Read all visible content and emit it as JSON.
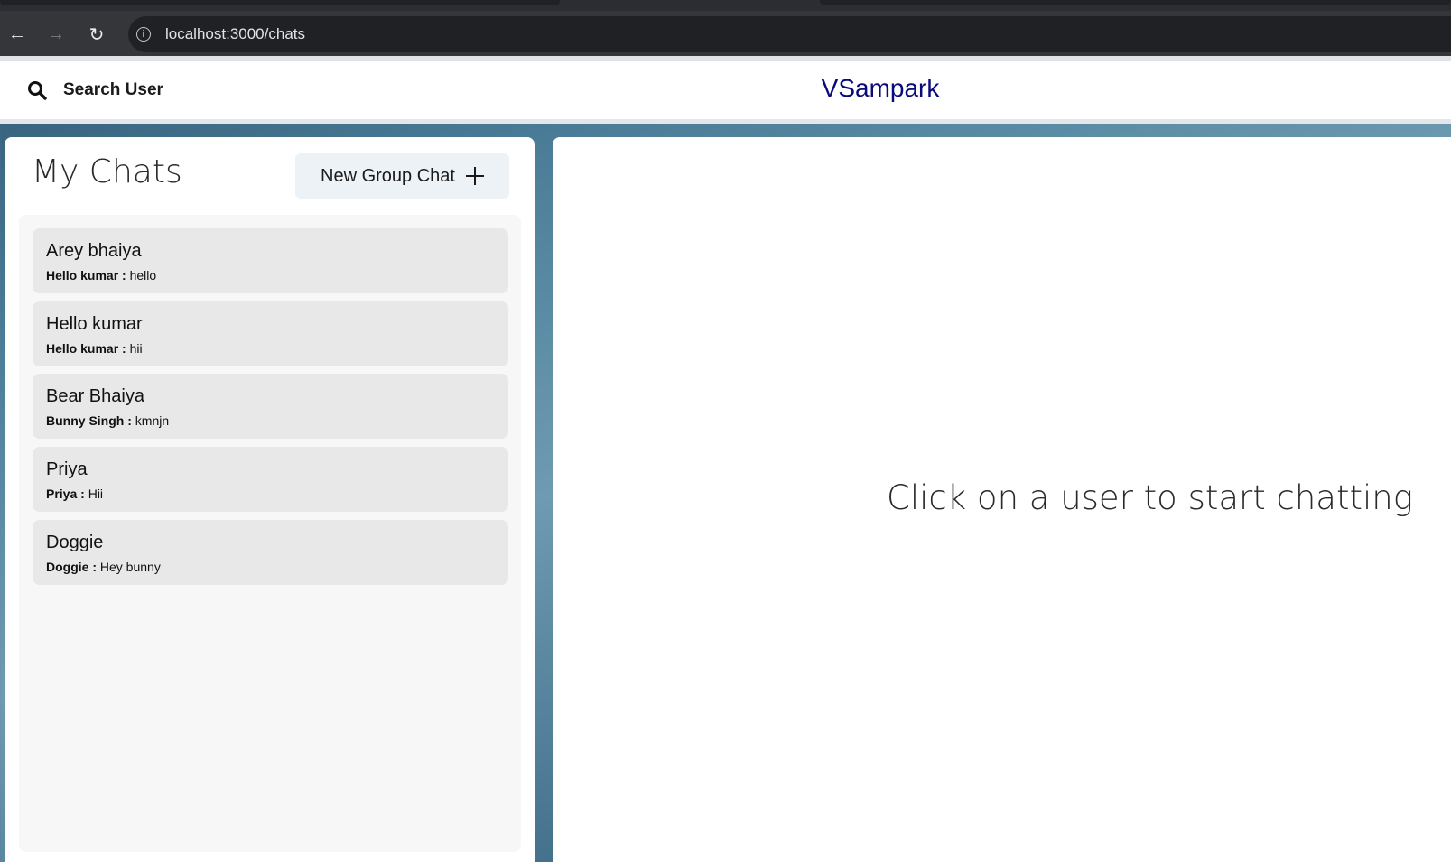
{
  "browser": {
    "url": "localhost:3000/chats",
    "back_icon": "←",
    "forward_icon": "→",
    "reload_icon": "↻",
    "info_icon": "i"
  },
  "header": {
    "search_label": "Search User",
    "brand": "VSampark"
  },
  "sidebar": {
    "title": "My Chats",
    "new_group_label": "New Group Chat",
    "chats": [
      {
        "name": "Arey bhaiya",
        "sender": "Hello kumar :",
        "message": "hello"
      },
      {
        "name": "Hello kumar",
        "sender": "Hello kumar :",
        "message": "hii"
      },
      {
        "name": "Bear Bhaiya",
        "sender": "Bunny Singh :",
        "message": "kmnjn"
      },
      {
        "name": "Priya",
        "sender": "Priya :",
        "message": "Hii"
      },
      {
        "name": "Doggie",
        "sender": "Doggie :",
        "message": "Hey bunny"
      }
    ]
  },
  "main": {
    "empty_message": "Click on a user to start chatting"
  },
  "colors": {
    "brand": "#0a0a7a",
    "chat_item_bg": "#e8e8e8",
    "button_bg": "#edf2f7"
  }
}
